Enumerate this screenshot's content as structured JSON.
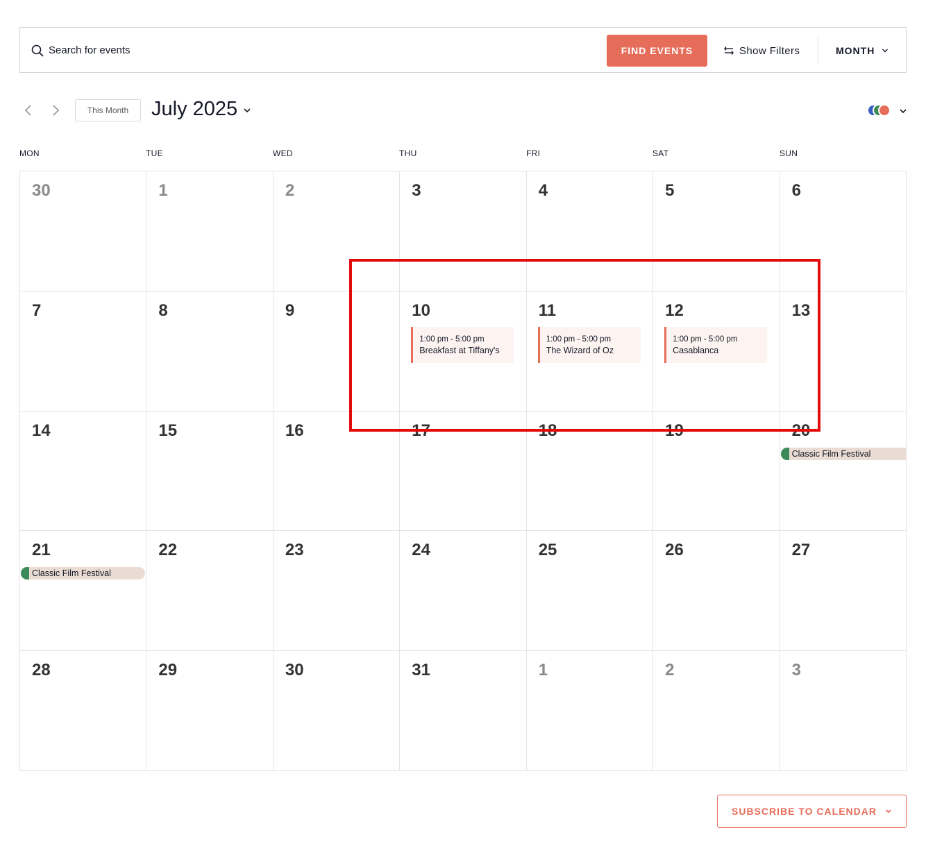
{
  "search": {
    "placeholder": "Search for events",
    "value": ""
  },
  "toolbar": {
    "find_label": "FIND EVENTS",
    "filters_label": "Show Filters",
    "view_label": "MONTH"
  },
  "nav": {
    "this_month_label": "This Month",
    "month_label": "July 2025"
  },
  "legend": {
    "colors": [
      "#3b5fc0",
      "#3d8a59",
      "#e66d5a"
    ]
  },
  "weekdays": [
    "MON",
    "TUE",
    "WED",
    "THU",
    "FRI",
    "SAT",
    "SUN"
  ],
  "weeks": [
    [
      {
        "day": "30",
        "other": true
      },
      {
        "day": "1",
        "other": true
      },
      {
        "day": "2",
        "other": true
      },
      {
        "day": "3"
      },
      {
        "day": "4"
      },
      {
        "day": "5"
      },
      {
        "day": "6"
      }
    ],
    [
      {
        "day": "7"
      },
      {
        "day": "8"
      },
      {
        "day": "9"
      },
      {
        "day": "10",
        "event": {
          "time": "1:00 pm - 5:00 pm",
          "title": "Breakfast at Tiffany's"
        }
      },
      {
        "day": "11",
        "event": {
          "time": "1:00 pm - 5:00 pm",
          "title": "The Wizard of Oz"
        }
      },
      {
        "day": "12",
        "event": {
          "time": "1:00 pm - 5:00 pm",
          "title": "Casablanca"
        }
      },
      {
        "day": "13"
      }
    ],
    [
      {
        "day": "14"
      },
      {
        "day": "15"
      },
      {
        "day": "16"
      },
      {
        "day": "17"
      },
      {
        "day": "18"
      },
      {
        "day": "19"
      },
      {
        "day": "20",
        "multi": {
          "title": "Classic Film Festival",
          "end": false
        }
      }
    ],
    [
      {
        "day": "21",
        "multi": {
          "title": "Classic Film Festival",
          "end": true
        }
      },
      {
        "day": "22"
      },
      {
        "day": "23"
      },
      {
        "day": "24"
      },
      {
        "day": "25"
      },
      {
        "day": "26"
      },
      {
        "day": "27"
      }
    ],
    [
      {
        "day": "28"
      },
      {
        "day": "29"
      },
      {
        "day": "30"
      },
      {
        "day": "31"
      },
      {
        "day": "1",
        "other": true
      },
      {
        "day": "2",
        "other": true
      },
      {
        "day": "3",
        "other": true
      }
    ]
  ],
  "subscribe": {
    "label": "SUBSCRIBE TO CALENDAR"
  }
}
